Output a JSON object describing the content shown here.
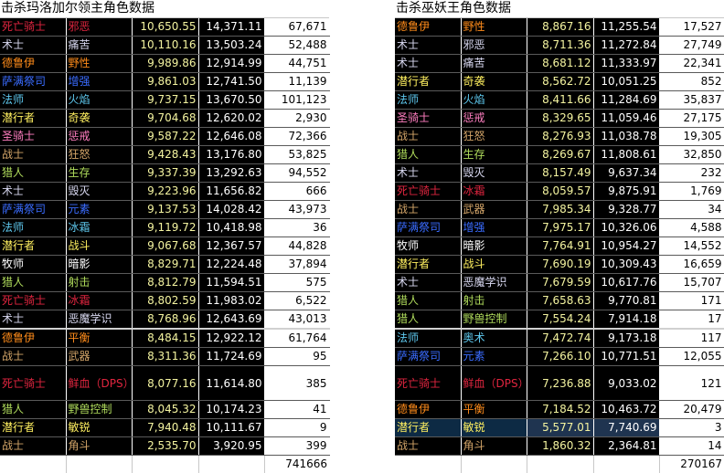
{
  "left": {
    "title": "击杀玛洛加尔领主角色数据",
    "total": "741666",
    "rows": [
      {
        "cls": "死亡骑士",
        "spec": "邪恶",
        "v1": "10,650.55",
        "v2": "14,371.11",
        "v3": "67,671"
      },
      {
        "cls": "术士",
        "spec": "痛苦",
        "v1": "10,110.16",
        "v2": "13,503.24",
        "v3": "52,488"
      },
      {
        "cls": "德鲁伊",
        "spec": "野性",
        "v1": "9,989.86",
        "v2": "12,914.99",
        "v3": "44,751"
      },
      {
        "cls": "萨满祭司",
        "spec": "增强",
        "v1": "9,861.03",
        "v2": "12,741.50",
        "v3": "11,139"
      },
      {
        "cls": "法师",
        "spec": "火焰",
        "v1": "9,737.15",
        "v2": "13,670.50",
        "v3": "101,123"
      },
      {
        "cls": "潜行者",
        "spec": "奇袭",
        "v1": "9,704.68",
        "v2": "12,620.02",
        "v3": "2,930"
      },
      {
        "cls": "圣骑士",
        "spec": "惩戒",
        "v1": "9,587.22",
        "v2": "12,646.08",
        "v3": "72,366"
      },
      {
        "cls": "战士",
        "spec": "狂怒",
        "v1": "9,428.43",
        "v2": "13,176.80",
        "v3": "53,825"
      },
      {
        "cls": "猎人",
        "spec": "生存",
        "v1": "9,337.39",
        "v2": "13,292.63",
        "v3": "94,552"
      },
      {
        "cls": "术士",
        "spec": "毁灭",
        "v1": "9,223.96",
        "v2": "11,656.82",
        "v3": "666"
      },
      {
        "cls": "萨满祭司",
        "spec": "元素",
        "v1": "9,137.53",
        "v2": "14,028.42",
        "v3": "43,973"
      },
      {
        "cls": "法师",
        "spec": "冰霜",
        "v1": "9,119.72",
        "v2": "10,418.98",
        "v3": "36"
      },
      {
        "cls": "潜行者",
        "spec": "战斗",
        "v1": "9,067.68",
        "v2": "12,367.57",
        "v3": "44,828"
      },
      {
        "cls": "牧师",
        "spec": "暗影",
        "v1": "8,829.71",
        "v2": "12,224.48",
        "v3": "37,894"
      },
      {
        "cls": "猎人",
        "spec": "射击",
        "v1": "8,812.79",
        "v2": "11,594.51",
        "v3": "575"
      },
      {
        "cls": "死亡骑士",
        "spec": "冰霜",
        "v1": "8,802.59",
        "v2": "11,983.02",
        "v3": "6,522"
      },
      {
        "cls": "术士",
        "spec": "恶魔学识",
        "v1": "8,768.96",
        "v2": "12,643.69",
        "v3": "43,013"
      },
      {
        "cls": "德鲁伊",
        "spec": "平衡",
        "v1": "8,484.15",
        "v2": "12,922.12",
        "v3": "61,764"
      },
      {
        "cls": "战士",
        "spec": "武器",
        "v1": "8,311.36",
        "v2": "11,724.69",
        "v3": "95"
      },
      {
        "cls": "死亡骑士",
        "spec": "鲜血（DPS）",
        "v1": "8,077.16",
        "v2": "11,614.80",
        "v3": "385"
      },
      {
        "cls": "猎人",
        "spec": "野兽控制",
        "v1": "8,045.32",
        "v2": "10,174.23",
        "v3": "41"
      },
      {
        "cls": "潜行者",
        "spec": "敏锐",
        "v1": "7,940.48",
        "v2": "10,111.67",
        "v3": "9"
      },
      {
        "cls": "战士",
        "spec": "角斗",
        "v1": "2,535.70",
        "v2": "3,920.95",
        "v3": "399"
      }
    ]
  },
  "right": {
    "title": "击杀巫妖王角色数据",
    "total": "270167",
    "rows": [
      {
        "cls": "德鲁伊",
        "spec": "野性",
        "v1": "8,867.16",
        "v2": "11,255.54",
        "v3": "17,527"
      },
      {
        "cls": "术士",
        "spec": "邪恶",
        "v1": "8,711.36",
        "v2": "11,272.84",
        "v3": "27,749"
      },
      {
        "cls": "术士",
        "spec": "痛苦",
        "v1": "8,681.12",
        "v2": "11,333.97",
        "v3": "22,341"
      },
      {
        "cls": "潜行者",
        "spec": "奇袭",
        "v1": "8,562.72",
        "v2": "10,051.25",
        "v3": "852"
      },
      {
        "cls": "法师",
        "spec": "火焰",
        "v1": "8,411.66",
        "v2": "11,284.69",
        "v3": "35,837"
      },
      {
        "cls": "圣骑士",
        "spec": "惩戒",
        "v1": "8,329.65",
        "v2": "11,059.46",
        "v3": "27,175"
      },
      {
        "cls": "战士",
        "spec": "狂怒",
        "v1": "8,276.93",
        "v2": "11,038.78",
        "v3": "19,305"
      },
      {
        "cls": "猎人",
        "spec": "生存",
        "v1": "8,269.67",
        "v2": "11,808.61",
        "v3": "32,850"
      },
      {
        "cls": "术士",
        "spec": "毁灭",
        "v1": "8,157.49",
        "v2": "9,637.34",
        "v3": "232"
      },
      {
        "cls": "死亡骑士",
        "spec": "冰霜",
        "v1": "8,059.57",
        "v2": "9,875.91",
        "v3": "1,769"
      },
      {
        "cls": "战士",
        "spec": "武器",
        "v1": "7,985.34",
        "v2": "9,328.77",
        "v3": "34"
      },
      {
        "cls": "萨满祭司",
        "spec": "增强",
        "v1": "7,975.17",
        "v2": "10,326.06",
        "v3": "4,588"
      },
      {
        "cls": "牧师",
        "spec": "暗影",
        "v1": "7,764.91",
        "v2": "10,954.27",
        "v3": "14,552"
      },
      {
        "cls": "潜行者",
        "spec": "战斗",
        "v1": "7,690.19",
        "v2": "10,309.43",
        "v3": "16,659"
      },
      {
        "cls": "术士",
        "spec": "恶魔学识",
        "v1": "7,679.59",
        "v2": "10,617.76",
        "v3": "15,707"
      },
      {
        "cls": "猎人",
        "spec": "射击",
        "v1": "7,658.63",
        "v2": "9,770.81",
        "v3": "171"
      },
      {
        "cls": "猎人",
        "spec": "野兽控制",
        "v1": "7,554.24",
        "v2": "7,914.18",
        "v3": "17"
      },
      {
        "cls": "法师",
        "spec": "奥术",
        "v1": "7,472.74",
        "v2": "9,173.18",
        "v3": "117"
      },
      {
        "cls": "萨满祭司",
        "spec": "元素",
        "v1": "7,266.10",
        "v2": "10,771.51",
        "v3": "12,055"
      },
      {
        "cls": "死亡骑士",
        "spec": "鲜血（DPS）",
        "v1": "7,236.88",
        "v2": "9,033.02",
        "v3": "121"
      },
      {
        "cls": "德鲁伊",
        "spec": "平衡",
        "v1": "7,184.52",
        "v2": "10,463.72",
        "v3": "20,479"
      },
      {
        "cls": "潜行者",
        "spec": "敏锐",
        "v1": "5,577.01",
        "v2": "7,740.69",
        "v3": "3"
      },
      {
        "cls": "战士",
        "spec": "角斗",
        "v1": "1,860.32",
        "v2": "2,364.81",
        "v3": "14"
      }
    ]
  },
  "class_colors": {
    "死亡骑士": "#e0253f",
    "术士": "#d8d8f0",
    "德鲁伊": "#ff8c1a",
    "萨满祭司": "#3a6cff",
    "法师": "#5ec8ee",
    "潜行者": "#fff060",
    "圣骑士": "#ff7ec0",
    "战士": "#d2a468",
    "猎人": "#b0dc5c",
    "牧师": "#ffffff"
  }
}
